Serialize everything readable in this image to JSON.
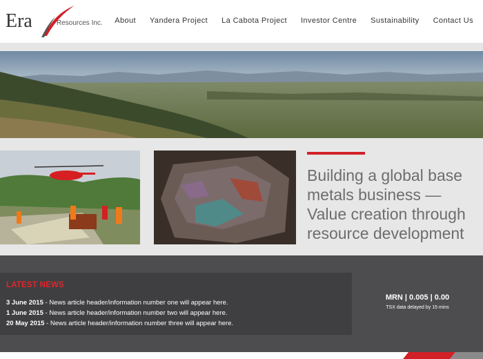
{
  "brand": {
    "name": "Era",
    "subtitle": "Resources Inc.",
    "accent_color": "#d22027"
  },
  "nav": {
    "items": [
      {
        "label": "About"
      },
      {
        "label": "Yandera Project"
      },
      {
        "label": "La Cabota Project"
      },
      {
        "label": "Investor Centre"
      },
      {
        "label": "Sustainability"
      },
      {
        "label": "Contact Us"
      }
    ]
  },
  "feature": {
    "tagline": "Building a global base metals business — Value creation through resource development"
  },
  "news": {
    "title": "LATEST NEWS",
    "items": [
      {
        "date": "3 June 2015",
        "text": " - News article header/information number one will appear here."
      },
      {
        "date": "1 June 2015",
        "text": " - News article header/information number two will appear here."
      },
      {
        "date": "20 May 2015",
        "text": " - News article header/information number three will appear here."
      }
    ]
  },
  "ticker": {
    "value": "MRN | 0.005 | 0.00",
    "note": "TSX data delayed by 15 mins"
  },
  "colors": {
    "dark_bg": "#4d4d4f",
    "news_bg": "#3f3f41",
    "news_title": "#e0262b"
  }
}
